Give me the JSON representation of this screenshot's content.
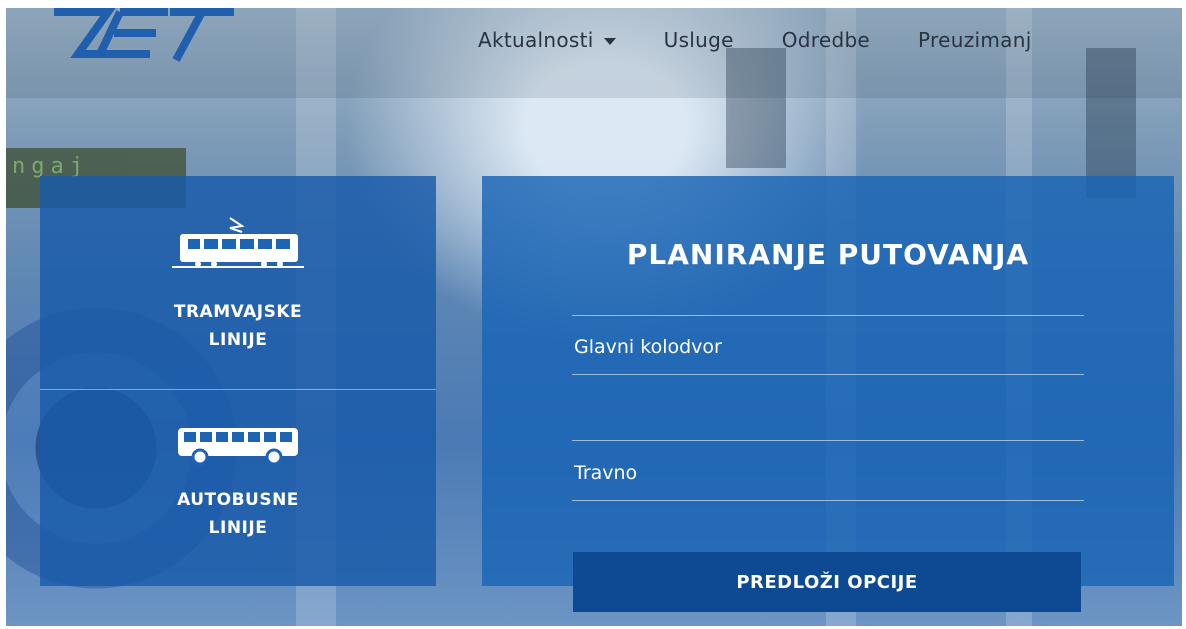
{
  "brand": {
    "logo_text": "ZET",
    "color": "#1f5fae"
  },
  "nav": {
    "items": [
      {
        "label": "Aktualnosti",
        "has_dropdown": true
      },
      {
        "label": "Usluge"
      },
      {
        "label": "Odredbe"
      },
      {
        "label": "Preuzimanj"
      }
    ]
  },
  "lines": {
    "tram": {
      "label_line1": "TRAMVAJSKE",
      "label_line2": "LINIJE",
      "icon": "tram-icon"
    },
    "bus": {
      "label_line1": "AUTOBUSNE",
      "label_line2": "LINIJE",
      "icon": "bus-icon"
    }
  },
  "planner": {
    "title": "PLANIRANJE PUTOVANJA",
    "from_value": "Glavni kolodvor",
    "via_value": "",
    "to_value": "Travno",
    "submit_label": "PREDLOŽI OPCIJE"
  },
  "colors": {
    "panel": "#1e64b4",
    "button": "#0d4a93",
    "text_nav": "#2a3340"
  }
}
